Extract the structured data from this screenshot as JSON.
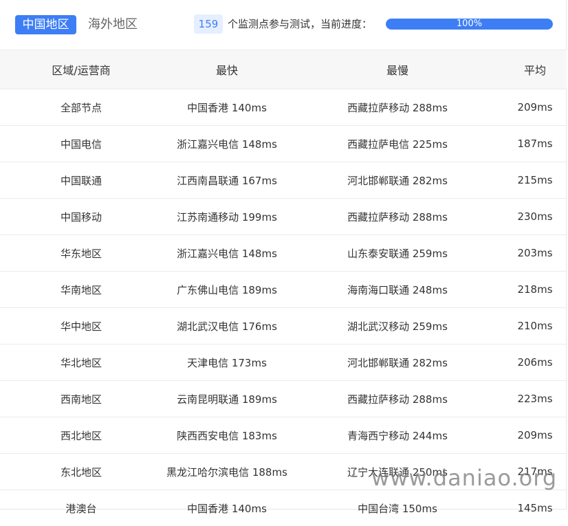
{
  "tabs": {
    "active_label": "中国地区",
    "inactive_label": "海外地区"
  },
  "summary": {
    "count": "159",
    "text": "个监测点参与测试，当前进度：",
    "progress_label": "100%",
    "progress_value": 1.0
  },
  "table": {
    "headers": [
      "区域/运营商",
      "最快",
      "最慢",
      "平均"
    ],
    "rows": [
      [
        "全部节点",
        "中国香港 140ms",
        "西藏拉萨移动 288ms",
        "209ms"
      ],
      [
        "中国电信",
        "浙江嘉兴电信 148ms",
        "西藏拉萨电信 225ms",
        "187ms"
      ],
      [
        "中国联通",
        "江西南昌联通 167ms",
        "河北邯郸联通 282ms",
        "215ms"
      ],
      [
        "中国移动",
        "江苏南通移动 199ms",
        "西藏拉萨移动 288ms",
        "230ms"
      ],
      [
        "华东地区",
        "浙江嘉兴电信 148ms",
        "山东泰安联通 259ms",
        "203ms"
      ],
      [
        "华南地区",
        "广东佛山电信 189ms",
        "海南海口联通 248ms",
        "218ms"
      ],
      [
        "华中地区",
        "湖北武汉电信 176ms",
        "湖北武汉移动 259ms",
        "210ms"
      ],
      [
        "华北地区",
        "天津电信 173ms",
        "河北邯郸联通 282ms",
        "206ms"
      ],
      [
        "西南地区",
        "云南昆明联通 189ms",
        "西藏拉萨移动 288ms",
        "223ms"
      ],
      [
        "西北地区",
        "陕西西安电信 183ms",
        "青海西宁移动 244ms",
        "209ms"
      ],
      [
        "东北地区",
        "黑龙江哈尔滨电信 188ms",
        "辽宁大连联通 250ms",
        "217ms"
      ],
      [
        "港澳台",
        "中国香港 140ms",
        "中国台湾 150ms",
        "145ms"
      ]
    ]
  },
  "watermark": "www.daniao.org",
  "colors": {
    "accent": "#3d7ef5",
    "badge_bg": "#e6efff",
    "header_bg": "#f7f7f7"
  }
}
